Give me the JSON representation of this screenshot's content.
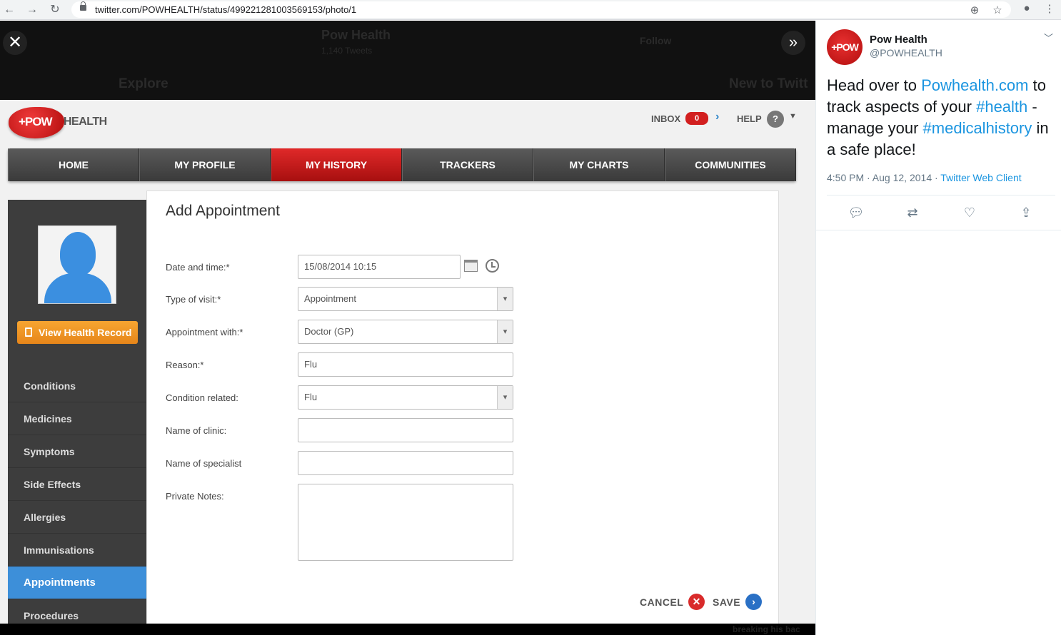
{
  "browser": {
    "url": "twitter.com/POWHEALTH/status/499221281003569153/photo/1"
  },
  "viewer": {
    "ghost_title": "Pow Health",
    "ghost_tweets": "1,140 Tweets",
    "ghost_explore": "Explore",
    "ghost_follow": "Follow",
    "ghost_new": "New to Twitt",
    "bottom_text": "breaking his bac"
  },
  "app": {
    "logo_pow": "+POW",
    "logo_health": "HEALTH",
    "inbox_label": "INBOX",
    "inbox_count": "0",
    "help_label": "HELP",
    "nav": [
      "HOME",
      "MY PROFILE",
      "MY HISTORY",
      "TRACKERS",
      "MY CHARTS",
      "COMMUNITIES"
    ],
    "view_health_record": "View Health Record",
    "sidebar": [
      "Conditions",
      "Medicines",
      "Symptoms",
      "Side Effects",
      "Allergies",
      "Immunisations",
      "Appointments",
      "Procedures"
    ],
    "form": {
      "title": "Add Appointment",
      "date_label": "Date and time:*",
      "date_value": "15/08/2014 10:15",
      "type_label": "Type of visit:*",
      "type_value": "Appointment",
      "with_label": "Appointment with:*",
      "with_value": "Doctor (GP)",
      "reason_label": "Reason:*",
      "reason_value": "Flu",
      "condition_label": "Condition related:",
      "condition_value": "Flu",
      "clinic_label": "Name of clinic:",
      "specialist_label": "Name of specialist",
      "notes_label": "Private Notes:",
      "cancel": "CANCEL",
      "save": "SAVE"
    }
  },
  "tweet": {
    "avatar_text": "+POW",
    "name": "Pow Health",
    "handle": "@POWHEALTH",
    "text_1": "Head over to ",
    "link": "Powhealth.com",
    "text_2": " to track aspects of your ",
    "hashtag_1": "#health",
    "text_3": " - manage your ",
    "hashtag_2": "#medicalhistory",
    "text_4": " in a safe place!",
    "time": "4:50 PM · Aug 12, 2014 · ",
    "client": "Twitter Web Client"
  }
}
